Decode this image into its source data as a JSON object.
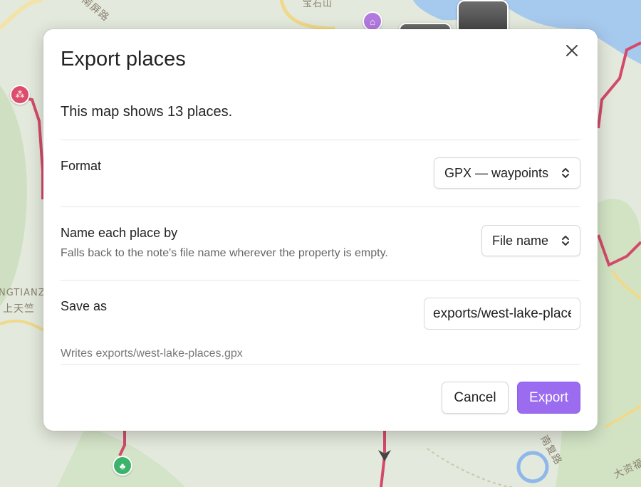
{
  "map": {
    "labels": {
      "top_left": "南屏路",
      "top_center": "宝石山",
      "left_en": "NGTIANZ",
      "left_cn": "上天竺",
      "bottom_right_road": "南复路",
      "bottom_right_corner": "大资福"
    },
    "colors": {
      "background": "#dfe7d6",
      "water": "#a6c9ee",
      "trail": "#d34a6a",
      "marker_red": "#dc4d6c",
      "marker_purple": "#b27ae0",
      "marker_green": "#3cb36a"
    }
  },
  "dialog": {
    "title": "Export places",
    "close_icon": "close-icon",
    "summary": "This map shows 13 places.",
    "format": {
      "label": "Format",
      "value": "GPX — waypoints"
    },
    "name_by": {
      "label": "Name each place by",
      "description": "Falls back to the note's file name wherever the property is empty.",
      "value": "File name"
    },
    "save_as": {
      "label": "Save as",
      "value": "exports/west-lake-places.gpx",
      "hint": "Writes exports/west-lake-places.gpx"
    },
    "buttons": {
      "cancel": "Cancel",
      "export": "Export"
    },
    "accent_color": "#9b6cf0"
  }
}
